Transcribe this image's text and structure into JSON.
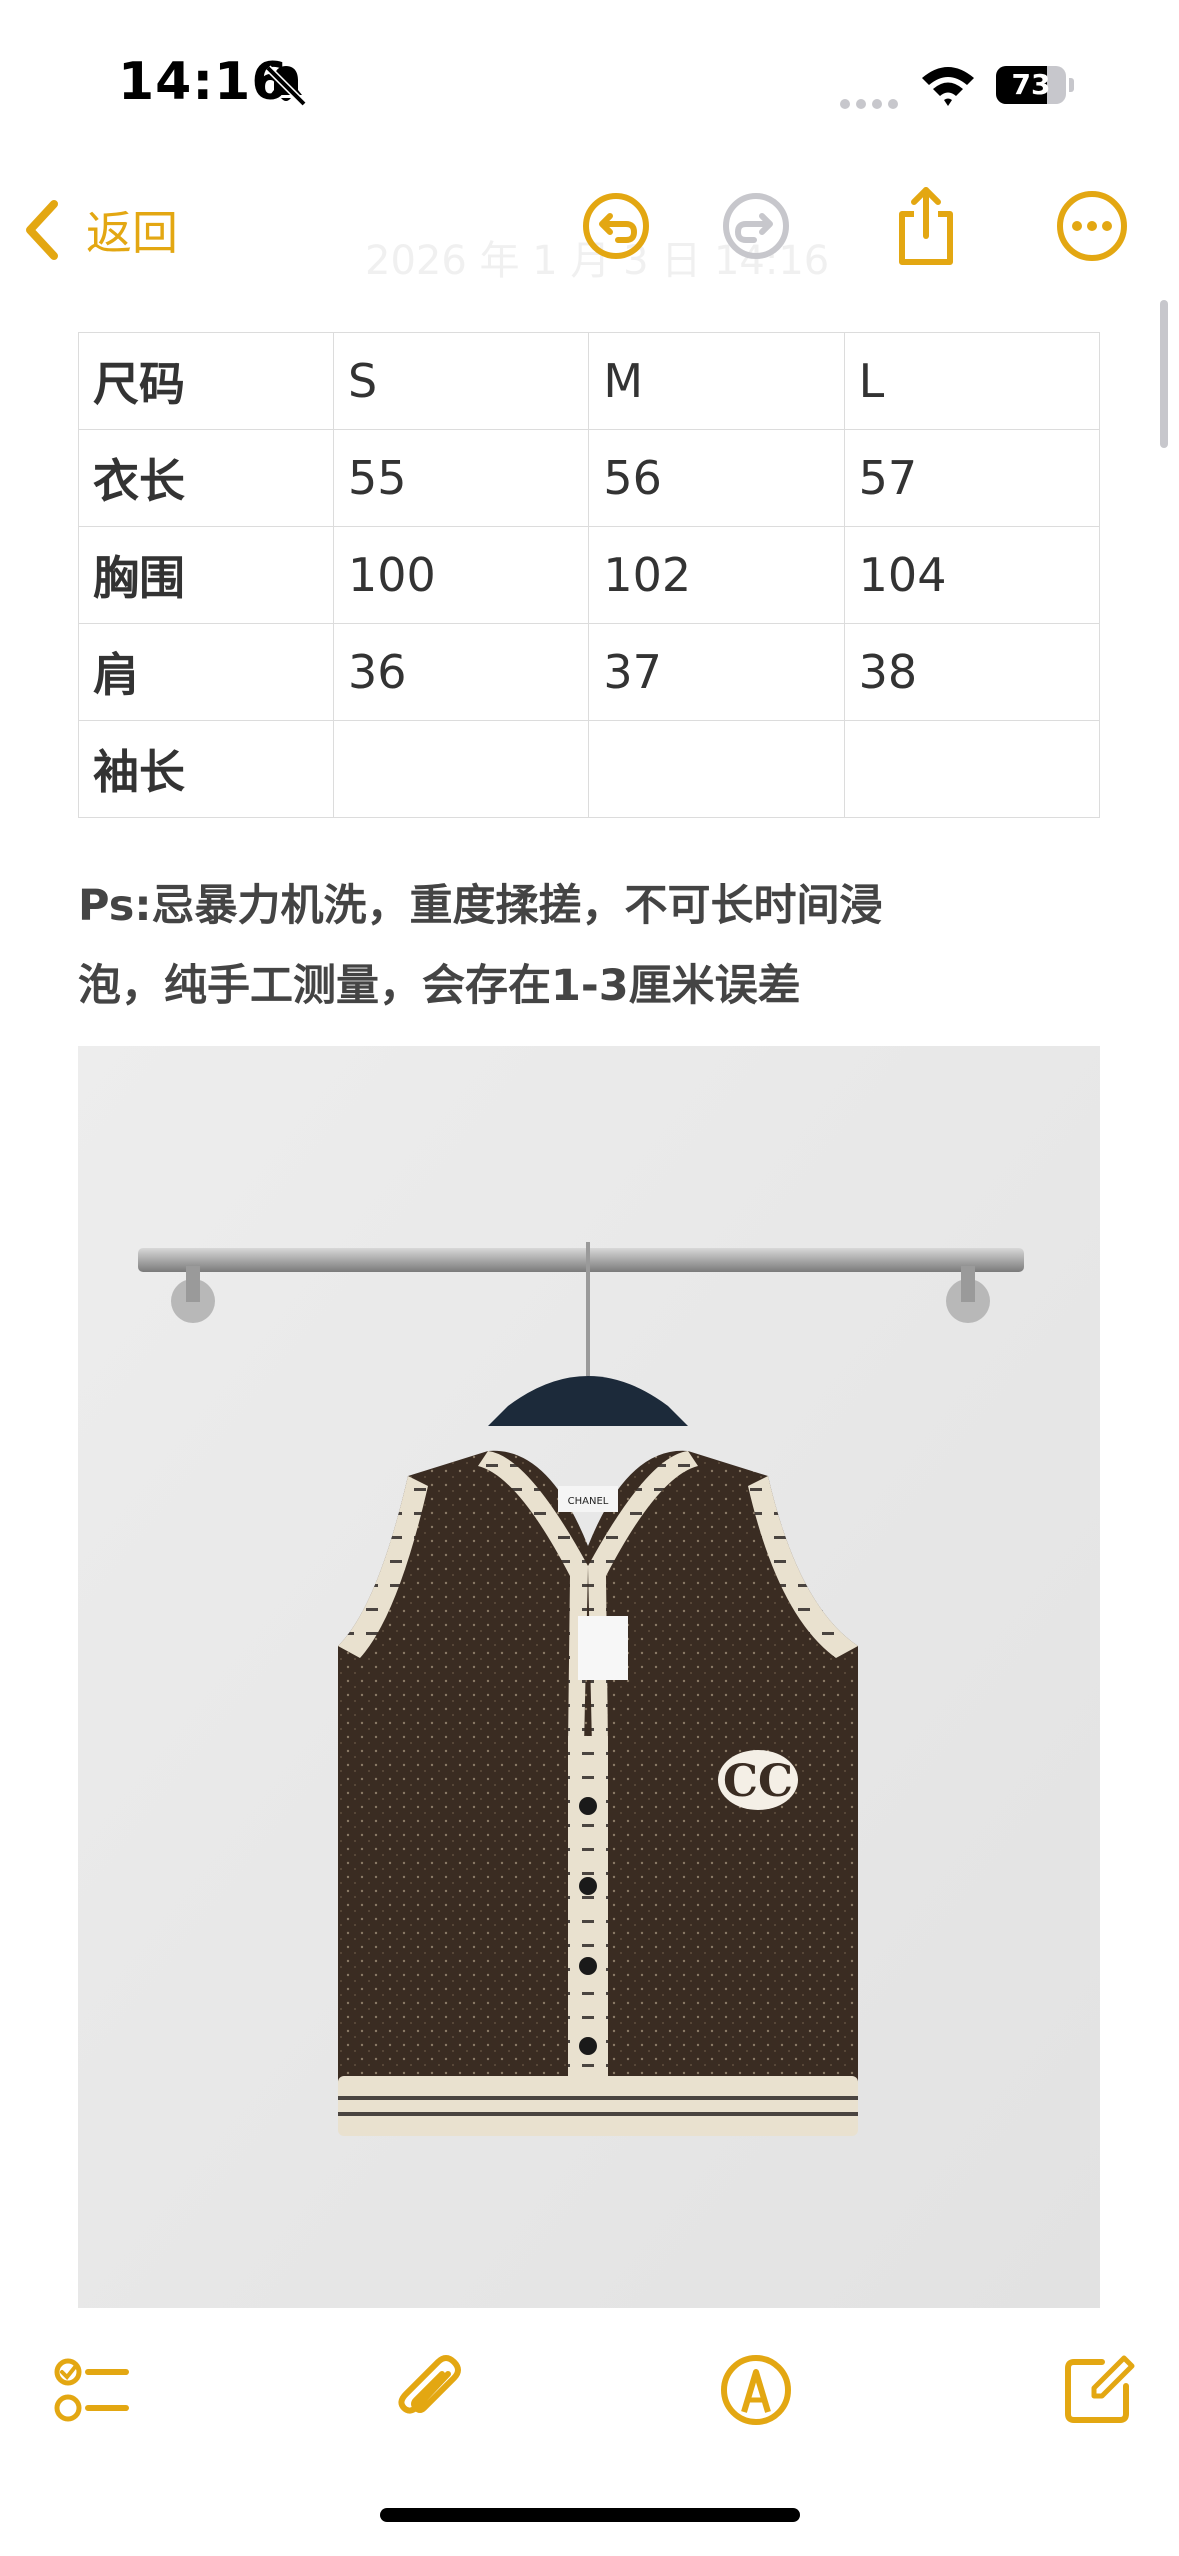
{
  "status": {
    "time": "14:16",
    "battery": "73",
    "battery_level": 0.73
  },
  "nav": {
    "back_label": "返回",
    "ghost_date": "2026 年 1 月 3 日 14:16"
  },
  "colors": {
    "accent": "#e3a712"
  },
  "table": {
    "rows": [
      [
        "尺码",
        "S",
        "M",
        "L"
      ],
      [
        "衣长",
        "55",
        "56",
        "57"
      ],
      [
        "胸围",
        "100",
        "102",
        "104"
      ],
      [
        "肩",
        "36",
        "37",
        "38"
      ],
      [
        "袖长",
        "",
        "",
        ""
      ]
    ]
  },
  "note": {
    "line1": "Ps:忌暴力机洗，重度揉搓，不可长时间浸",
    "line2": "泡，纯手工测量，会存在1-3厘米误差"
  },
  "photo": {
    "tag_text": "CHANEL",
    "logo": "CC"
  },
  "icons": {
    "back": "chevron-left-icon",
    "undo": "undo-icon",
    "redo": "redo-icon",
    "share": "share-icon",
    "more": "more-icon",
    "checklist": "checklist-icon",
    "attach": "paperclip-icon",
    "markup": "markup-pen-icon",
    "compose": "compose-icon"
  }
}
